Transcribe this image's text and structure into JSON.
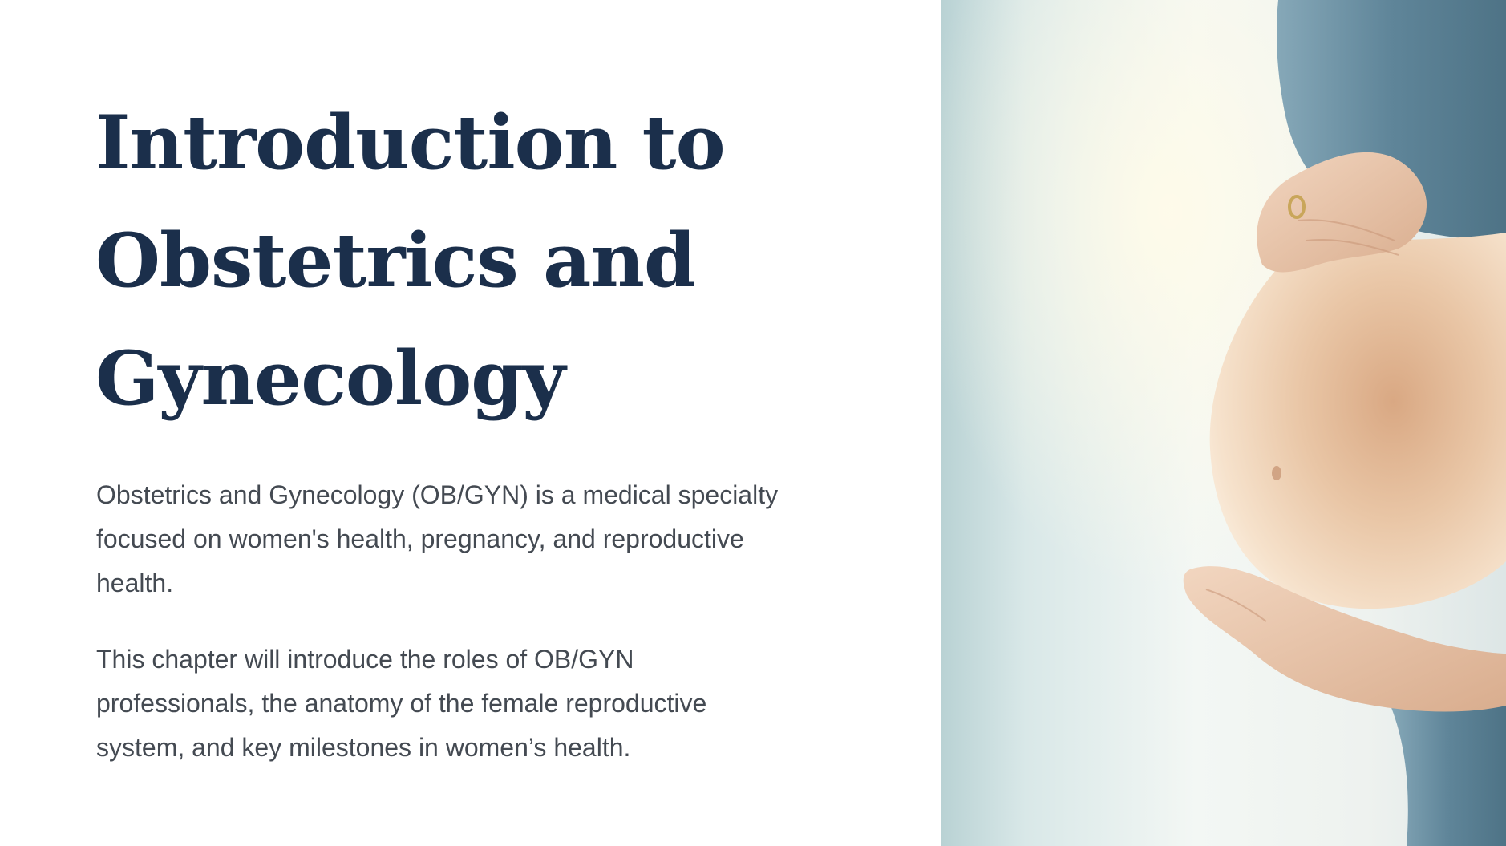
{
  "slide": {
    "title_lines": [
      "Introduction to",
      "Obstetrics and",
      "Gynecology"
    ],
    "paragraph_1_lines": [
      "Obstetrics and Gynecology (OB/GYN) is a medical specialty",
      "focused on women's health, pregnancy, and reproductive",
      "health."
    ],
    "paragraph_2_lines": [
      "This chapter will introduce the roles of OB/GYN",
      "professionals, the anatomy of the female reproductive",
      "system, and key milestones in women’s health."
    ]
  },
  "colors": {
    "title": "#1b2f4b",
    "body_text": "#444a52",
    "background": "#ffffff",
    "garment": "#5f8599",
    "skin": "#e7c4a4"
  }
}
